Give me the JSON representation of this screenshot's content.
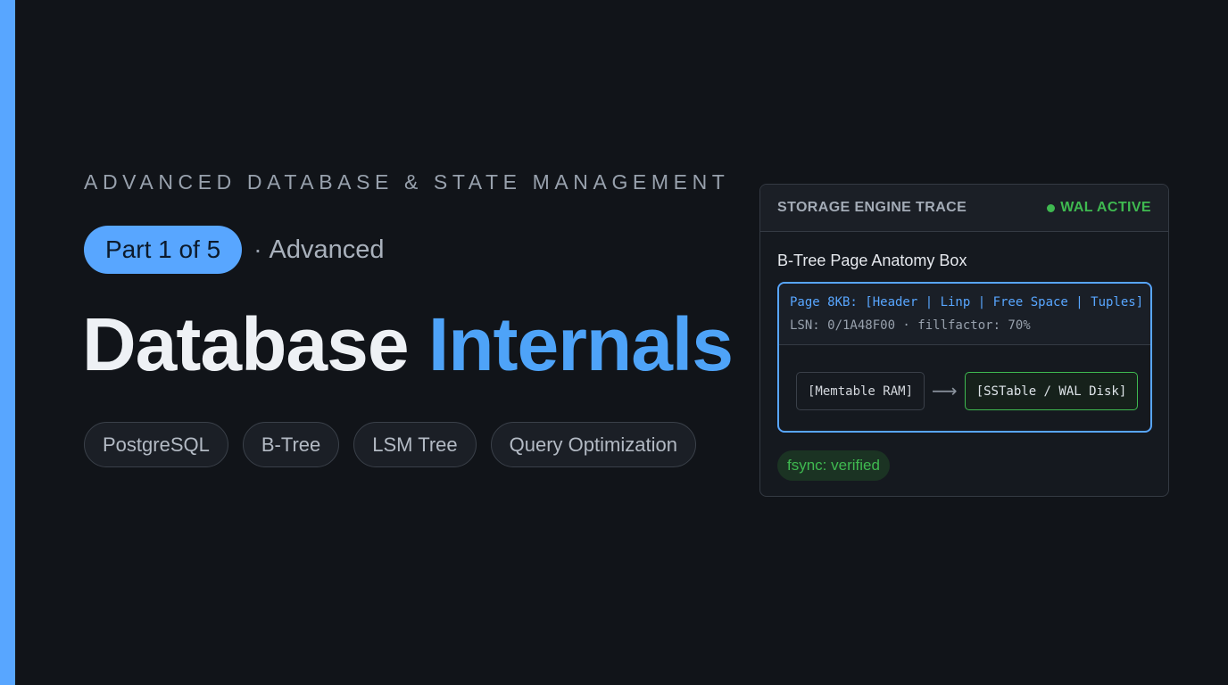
{
  "colors": {
    "background": "#111419",
    "accent": "#58a6ff",
    "title_highlight": "#4ea3f8",
    "success": "#3fb950"
  },
  "header": {
    "kicker": "ADVANCED DATABASE & STATE MANAGEMENT",
    "part_label": "Part 1 of 5",
    "separator": "·",
    "level": "Advanced"
  },
  "title": {
    "word1": "Database",
    "word2": "Internals"
  },
  "tags": [
    "PostgreSQL",
    "B-Tree",
    "LSM Tree",
    "Query Optimization"
  ],
  "card": {
    "title": "STORAGE ENGINE TRACE",
    "status_icon": "status-dot-icon",
    "status": "WAL ACTIVE",
    "box_label": "B-Tree Page Anatomy Box",
    "page_line": "Page 8KB: [Header | Linp | Free Space | Tuples]",
    "lsn_line": "LSN: 0/1A48F00 · fillfactor: 70%",
    "memtable": "[Memtable RAM]",
    "arrow": "⟶",
    "sstable": "[SSTable / WAL Disk]",
    "fsync": "fsync: verified"
  }
}
